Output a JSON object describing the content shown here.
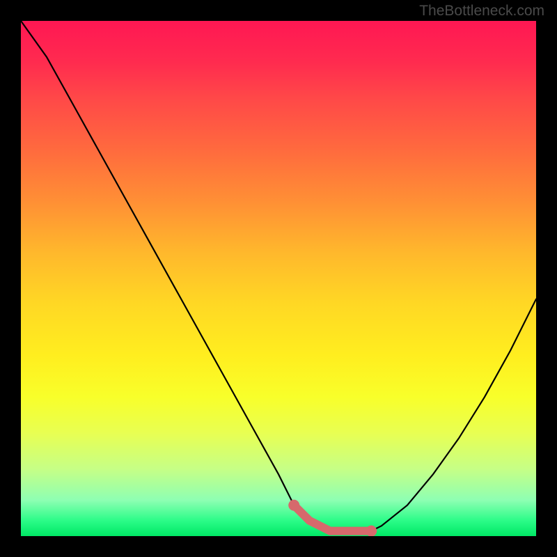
{
  "watermark": "TheBottleneck.com",
  "chart_data": {
    "type": "line",
    "title": "",
    "xlabel": "",
    "ylabel": "",
    "xlim": [
      0,
      100
    ],
    "ylim": [
      0,
      100
    ],
    "series": [
      {
        "name": "bottleneck-curve",
        "x": [
          0,
          5,
          10,
          15,
          20,
          25,
          30,
          35,
          40,
          45,
          50,
          53,
          56,
          60,
          65,
          68,
          70,
          75,
          80,
          85,
          90,
          95,
          100
        ],
        "y": [
          100,
          93,
          84,
          75,
          66,
          57,
          48,
          39,
          30,
          21,
          12,
          6,
          3,
          1,
          1,
          1,
          2,
          6,
          12,
          19,
          27,
          36,
          46
        ],
        "color": "#000000"
      }
    ],
    "accent_segment": {
      "color": "#d6696c",
      "x": [
        53,
        56,
        60,
        65,
        68
      ],
      "y": [
        6,
        3,
        1,
        1,
        1
      ]
    },
    "gradient_stops": [
      {
        "pos": 0,
        "color": "#ff1753"
      },
      {
        "pos": 50,
        "color": "#ffe222"
      },
      {
        "pos": 100,
        "color": "#00e865"
      }
    ]
  }
}
